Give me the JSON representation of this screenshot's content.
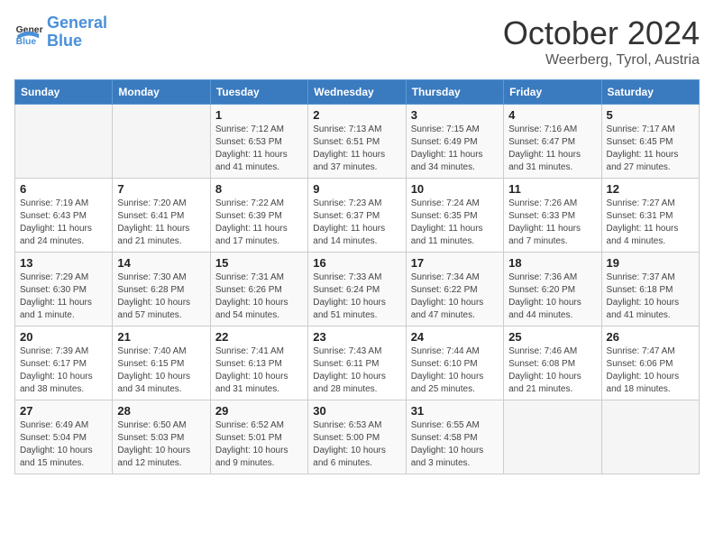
{
  "header": {
    "logo_general": "General",
    "logo_blue": "Blue",
    "title": "October 2024",
    "location": "Weerberg, Tyrol, Austria"
  },
  "weekdays": [
    "Sunday",
    "Monday",
    "Tuesday",
    "Wednesday",
    "Thursday",
    "Friday",
    "Saturday"
  ],
  "weeks": [
    [
      {
        "day": "",
        "info": ""
      },
      {
        "day": "",
        "info": ""
      },
      {
        "day": "1",
        "info": "Sunrise: 7:12 AM\nSunset: 6:53 PM\nDaylight: 11 hours and 41 minutes."
      },
      {
        "day": "2",
        "info": "Sunrise: 7:13 AM\nSunset: 6:51 PM\nDaylight: 11 hours and 37 minutes."
      },
      {
        "day": "3",
        "info": "Sunrise: 7:15 AM\nSunset: 6:49 PM\nDaylight: 11 hours and 34 minutes."
      },
      {
        "day": "4",
        "info": "Sunrise: 7:16 AM\nSunset: 6:47 PM\nDaylight: 11 hours and 31 minutes."
      },
      {
        "day": "5",
        "info": "Sunrise: 7:17 AM\nSunset: 6:45 PM\nDaylight: 11 hours and 27 minutes."
      }
    ],
    [
      {
        "day": "6",
        "info": "Sunrise: 7:19 AM\nSunset: 6:43 PM\nDaylight: 11 hours and 24 minutes."
      },
      {
        "day": "7",
        "info": "Sunrise: 7:20 AM\nSunset: 6:41 PM\nDaylight: 11 hours and 21 minutes."
      },
      {
        "day": "8",
        "info": "Sunrise: 7:22 AM\nSunset: 6:39 PM\nDaylight: 11 hours and 17 minutes."
      },
      {
        "day": "9",
        "info": "Sunrise: 7:23 AM\nSunset: 6:37 PM\nDaylight: 11 hours and 14 minutes."
      },
      {
        "day": "10",
        "info": "Sunrise: 7:24 AM\nSunset: 6:35 PM\nDaylight: 11 hours and 11 minutes."
      },
      {
        "day": "11",
        "info": "Sunrise: 7:26 AM\nSunset: 6:33 PM\nDaylight: 11 hours and 7 minutes."
      },
      {
        "day": "12",
        "info": "Sunrise: 7:27 AM\nSunset: 6:31 PM\nDaylight: 11 hours and 4 minutes."
      }
    ],
    [
      {
        "day": "13",
        "info": "Sunrise: 7:29 AM\nSunset: 6:30 PM\nDaylight: 11 hours and 1 minute."
      },
      {
        "day": "14",
        "info": "Sunrise: 7:30 AM\nSunset: 6:28 PM\nDaylight: 10 hours and 57 minutes."
      },
      {
        "day": "15",
        "info": "Sunrise: 7:31 AM\nSunset: 6:26 PM\nDaylight: 10 hours and 54 minutes."
      },
      {
        "day": "16",
        "info": "Sunrise: 7:33 AM\nSunset: 6:24 PM\nDaylight: 10 hours and 51 minutes."
      },
      {
        "day": "17",
        "info": "Sunrise: 7:34 AM\nSunset: 6:22 PM\nDaylight: 10 hours and 47 minutes."
      },
      {
        "day": "18",
        "info": "Sunrise: 7:36 AM\nSunset: 6:20 PM\nDaylight: 10 hours and 44 minutes."
      },
      {
        "day": "19",
        "info": "Sunrise: 7:37 AM\nSunset: 6:18 PM\nDaylight: 10 hours and 41 minutes."
      }
    ],
    [
      {
        "day": "20",
        "info": "Sunrise: 7:39 AM\nSunset: 6:17 PM\nDaylight: 10 hours and 38 minutes."
      },
      {
        "day": "21",
        "info": "Sunrise: 7:40 AM\nSunset: 6:15 PM\nDaylight: 10 hours and 34 minutes."
      },
      {
        "day": "22",
        "info": "Sunrise: 7:41 AM\nSunset: 6:13 PM\nDaylight: 10 hours and 31 minutes."
      },
      {
        "day": "23",
        "info": "Sunrise: 7:43 AM\nSunset: 6:11 PM\nDaylight: 10 hours and 28 minutes."
      },
      {
        "day": "24",
        "info": "Sunrise: 7:44 AM\nSunset: 6:10 PM\nDaylight: 10 hours and 25 minutes."
      },
      {
        "day": "25",
        "info": "Sunrise: 7:46 AM\nSunset: 6:08 PM\nDaylight: 10 hours and 21 minutes."
      },
      {
        "day": "26",
        "info": "Sunrise: 7:47 AM\nSunset: 6:06 PM\nDaylight: 10 hours and 18 minutes."
      }
    ],
    [
      {
        "day": "27",
        "info": "Sunrise: 6:49 AM\nSunset: 5:04 PM\nDaylight: 10 hours and 15 minutes."
      },
      {
        "day": "28",
        "info": "Sunrise: 6:50 AM\nSunset: 5:03 PM\nDaylight: 10 hours and 12 minutes."
      },
      {
        "day": "29",
        "info": "Sunrise: 6:52 AM\nSunset: 5:01 PM\nDaylight: 10 hours and 9 minutes."
      },
      {
        "day": "30",
        "info": "Sunrise: 6:53 AM\nSunset: 5:00 PM\nDaylight: 10 hours and 6 minutes."
      },
      {
        "day": "31",
        "info": "Sunrise: 6:55 AM\nSunset: 4:58 PM\nDaylight: 10 hours and 3 minutes."
      },
      {
        "day": "",
        "info": ""
      },
      {
        "day": "",
        "info": ""
      }
    ]
  ]
}
